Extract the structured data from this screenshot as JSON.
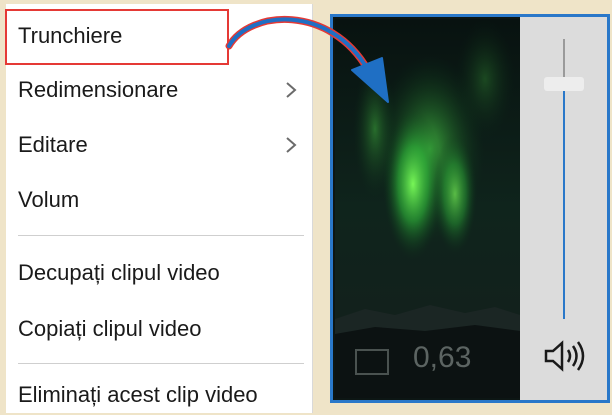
{
  "context_menu": {
    "items": [
      {
        "label": "Trunchiere",
        "has_submenu": false,
        "highlighted": true
      },
      {
        "label": "Redimensionare",
        "has_submenu": true
      },
      {
        "label": "Editare",
        "has_submenu": true
      },
      {
        "label": "Volum",
        "has_submenu": false
      },
      {
        "label": "Decupați clipul video",
        "has_submenu": false
      },
      {
        "label": "Copiați clipul video",
        "has_submenu": false
      },
      {
        "label": "Eliminați acest clip video",
        "has_submenu": false
      }
    ]
  },
  "preview": {
    "volume_value": "0,63",
    "volume_level": 0.8
  },
  "colors": {
    "highlight": "#e53935",
    "accent": "#2a78c9",
    "arrow": "#1f6fc4"
  }
}
